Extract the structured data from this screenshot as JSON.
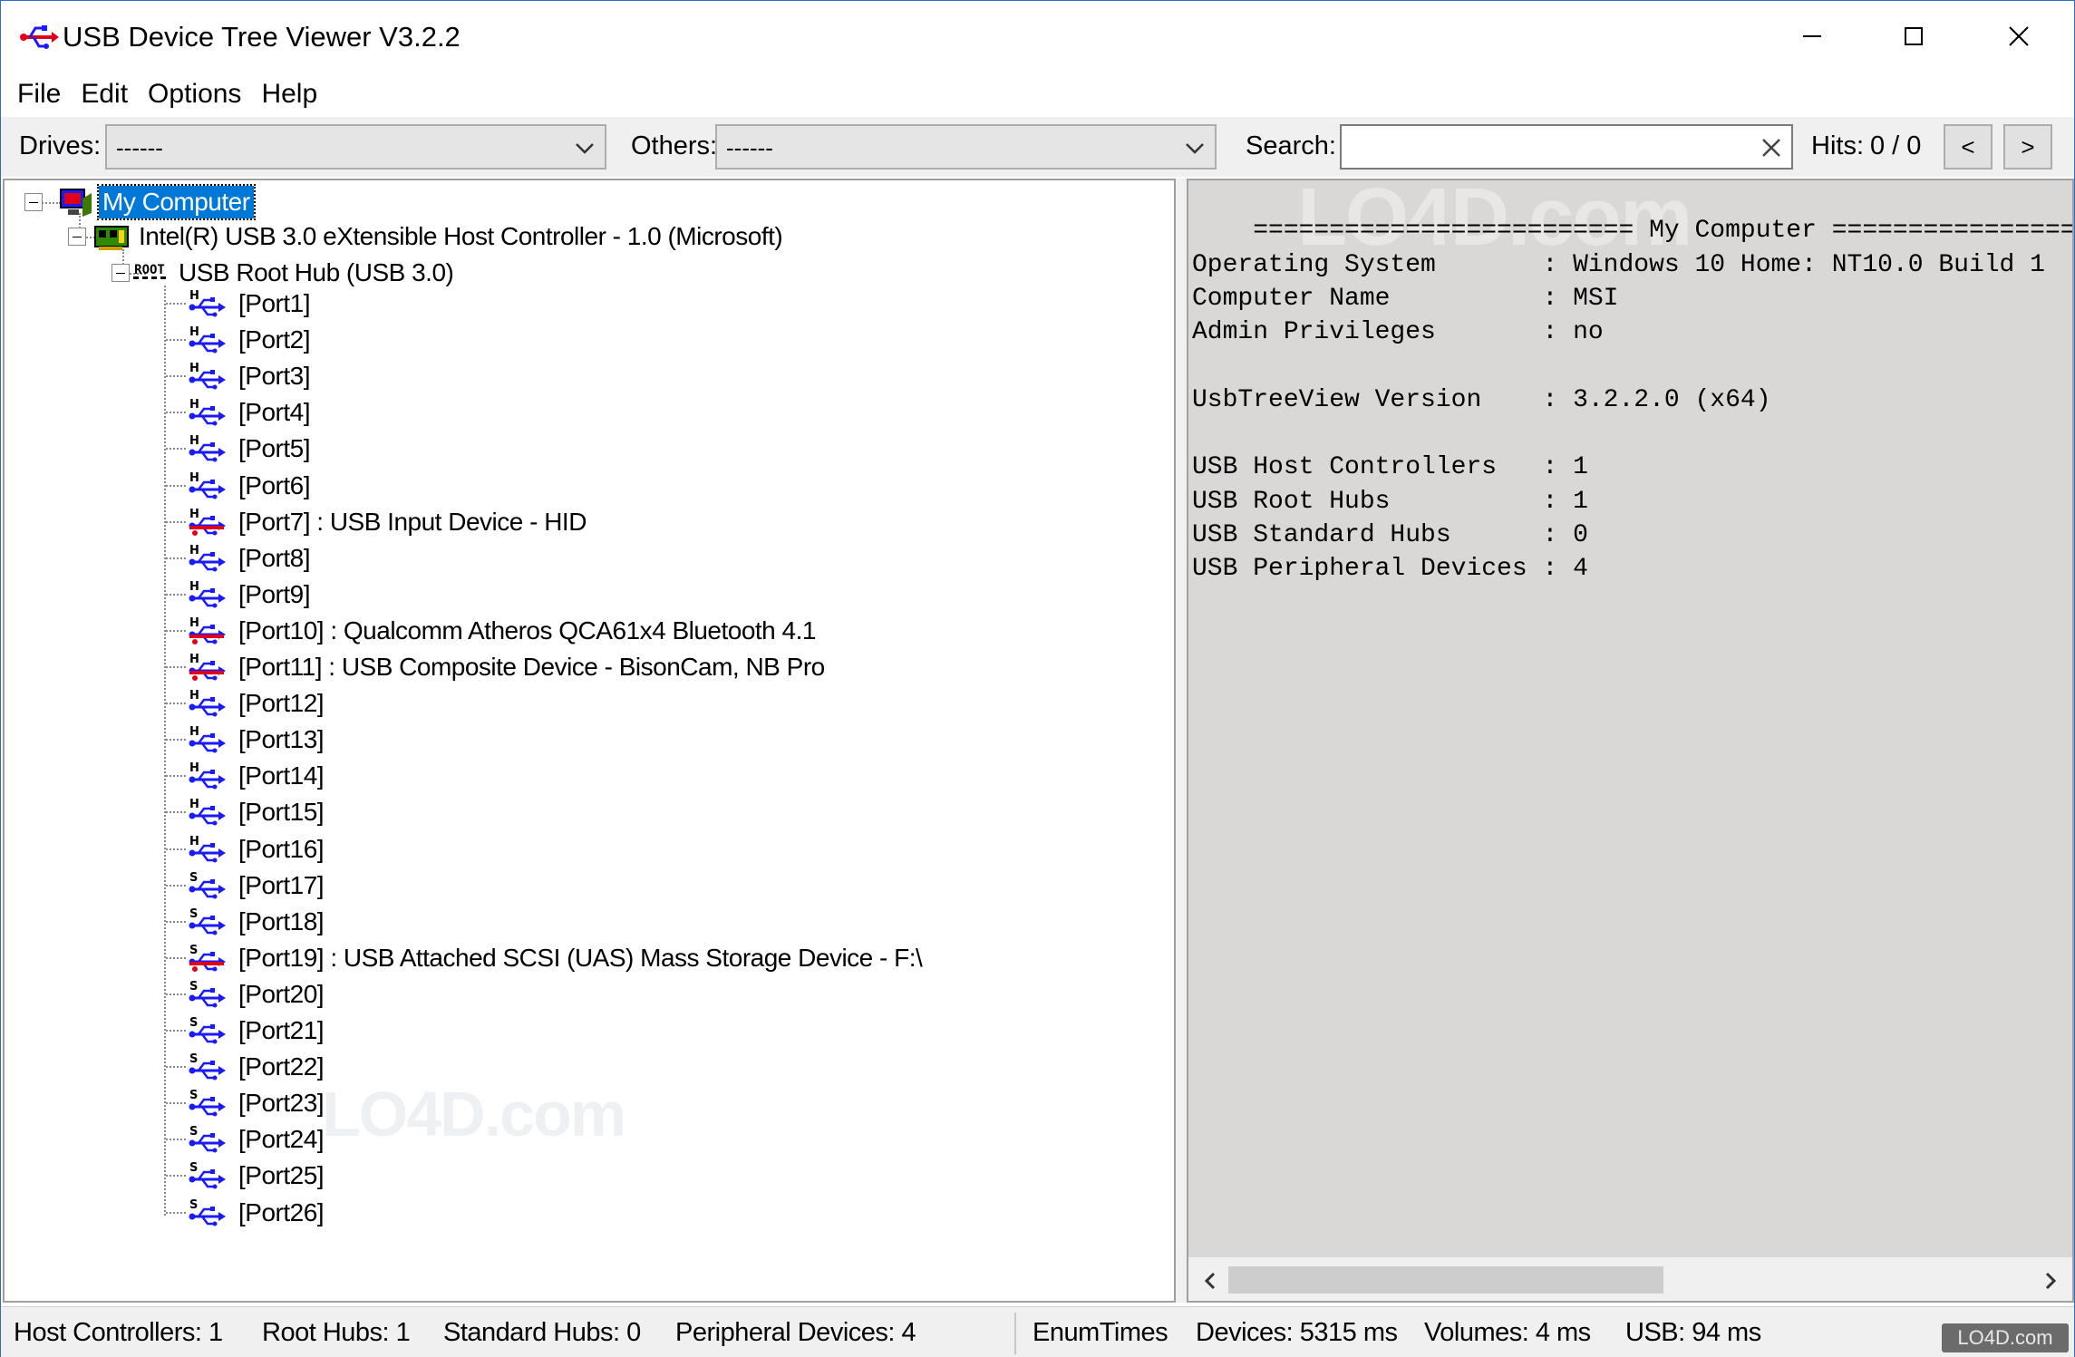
{
  "window": {
    "title": "USB Device Tree Viewer V3.2.2"
  },
  "menu": [
    "File",
    "Edit",
    "Options",
    "Help"
  ],
  "toolbar": {
    "drives_label": "Drives:",
    "drives_value": "------",
    "others_label": "Others:",
    "others_value": "------",
    "search_label": "Search:",
    "search_value": "",
    "hits_label": "Hits:",
    "hits_value": "0 / 0",
    "prev_label": "<",
    "next_label": ">"
  },
  "tree": {
    "root": "My Computer",
    "controller": "Intel(R) USB 3.0 eXtensible Host Controller - 1.0 (Microsoft)",
    "hub_badge": "ROOT",
    "hub": "USB Root Hub (USB 3.0)",
    "ports": [
      {
        "label": "[Port1]",
        "type": "H",
        "connected": false
      },
      {
        "label": "[Port2]",
        "type": "H",
        "connected": false
      },
      {
        "label": "[Port3]",
        "type": "H",
        "connected": false
      },
      {
        "label": "[Port4]",
        "type": "H",
        "connected": false
      },
      {
        "label": "[Port5]",
        "type": "H",
        "connected": false
      },
      {
        "label": "[Port6]",
        "type": "H",
        "connected": false
      },
      {
        "label": "[Port7] : USB Input Device - HID",
        "type": "H",
        "connected": true
      },
      {
        "label": "[Port8]",
        "type": "H",
        "connected": false
      },
      {
        "label": "[Port9]",
        "type": "H",
        "connected": false
      },
      {
        "label": "[Port10] : Qualcomm Atheros QCA61x4 Bluetooth 4.1",
        "type": "H",
        "connected": true
      },
      {
        "label": "[Port11] : USB Composite Device - BisonCam, NB Pro",
        "type": "H",
        "connected": true
      },
      {
        "label": "[Port12]",
        "type": "H",
        "connected": false
      },
      {
        "label": "[Port13]",
        "type": "H",
        "connected": false
      },
      {
        "label": "[Port14]",
        "type": "H",
        "connected": false
      },
      {
        "label": "[Port15]",
        "type": "H",
        "connected": false
      },
      {
        "label": "[Port16]",
        "type": "H",
        "connected": false
      },
      {
        "label": "[Port17]",
        "type": "S",
        "connected": false
      },
      {
        "label": "[Port18]",
        "type": "S",
        "connected": false
      },
      {
        "label": "[Port19] : USB Attached SCSI (UAS) Mass Storage Device - F:\\",
        "type": "S",
        "connected": true
      },
      {
        "label": "[Port20]",
        "type": "S",
        "connected": false
      },
      {
        "label": "[Port21]",
        "type": "S",
        "connected": false
      },
      {
        "label": "[Port22]",
        "type": "S",
        "connected": false
      },
      {
        "label": "[Port23]",
        "type": "S",
        "connected": false
      },
      {
        "label": "[Port24]",
        "type": "S",
        "connected": false
      },
      {
        "label": "[Port25]",
        "type": "S",
        "connected": false
      },
      {
        "label": "[Port26]",
        "type": "S",
        "connected": false
      }
    ]
  },
  "details": {
    "lines": [
      "",
      "    ========================= My Computer =========================",
      "Operating System       : Windows 10 Home: NT10.0 Build 1",
      "Computer Name          : MSI",
      "Admin Privileges       : no",
      "",
      "UsbTreeView Version    : 3.2.2.0 (x64)",
      "",
      "USB Host Controllers   : 1",
      "USB Root Hubs          : 1",
      "USB Standard Hubs      : 0",
      "USB Peripheral Devices : 4"
    ]
  },
  "status": {
    "host_controllers": "Host Controllers: 1",
    "root_hubs": "Root Hubs: 1",
    "standard_hubs": "Standard Hubs: 0",
    "peripheral_devices": "Peripheral Devices: 4",
    "enum_times": "EnumTimes",
    "devices": "Devices: 5315 ms",
    "volumes": "Volumes: 4 ms",
    "usb": "USB: 94 ms"
  },
  "watermark": {
    "text": "LO4D.com",
    "badge": "LO4D.com"
  },
  "colors": {
    "accent": "#0078d7",
    "usb_icon": "#1a1aff",
    "usb_connected": "#e0001a",
    "pane_bg": "#d9d8d7"
  }
}
